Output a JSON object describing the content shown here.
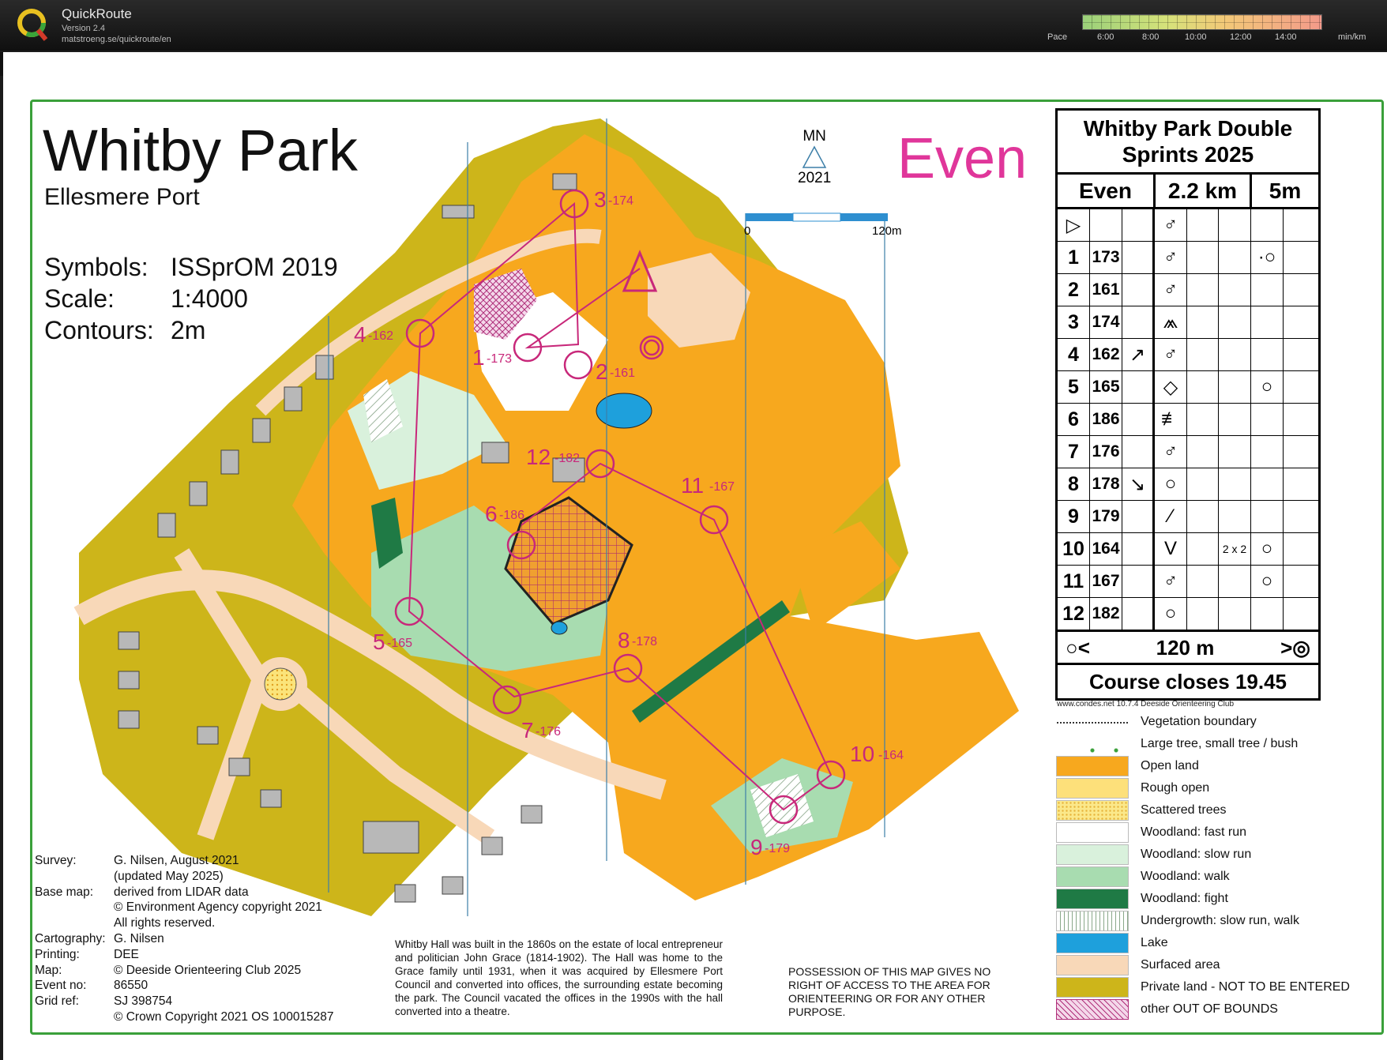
{
  "app": {
    "name": "QuickRoute",
    "version": "Version 2.4",
    "url": "matstroeng.se/quickroute/en",
    "pace_label": "Pace",
    "pace_ticks": [
      "6:00",
      "8:00",
      "10:00",
      "12:00",
      "14:00"
    ],
    "pace_unit": "min/km"
  },
  "map": {
    "title": "Whitby Park",
    "subtitle": "Ellesmere Port",
    "info": [
      {
        "label": "Symbols:",
        "value": "ISSprOM 2019"
      },
      {
        "label": "Scale:",
        "value": "1:4000"
      },
      {
        "label": "Contours:",
        "value": "2m"
      }
    ],
    "course_name": "Even",
    "north_label": "MN",
    "year_label": "2021",
    "scale_start": "0",
    "scale_end": "120m",
    "controls_on_map": [
      {
        "num": "1",
        "code": "-173"
      },
      {
        "num": "2",
        "code": "-161"
      },
      {
        "num": "3",
        "code": "-174"
      },
      {
        "num": "4",
        "code": "-162"
      },
      {
        "num": "5",
        "code": "-165"
      },
      {
        "num": "6",
        "code": "-186"
      },
      {
        "num": "7",
        "code": "-176"
      },
      {
        "num": "8",
        "code": "-178"
      },
      {
        "num": "9",
        "code": "-179"
      },
      {
        "num": "10",
        "code": "-164"
      },
      {
        "num": "11",
        "code": "-167"
      },
      {
        "num": "12",
        "code": "-182"
      }
    ]
  },
  "control_card": {
    "title_line1": "Whitby Park Double",
    "title_line2": "Sprints 2025",
    "course": "Even",
    "length": "2.2 km",
    "climb": "5m",
    "start_symbol": "▷",
    "rows": [
      {
        "num": "1",
        "code": "173",
        "dir": "",
        "feature": "♂",
        "dim": "",
        "loc": "·○"
      },
      {
        "num": "2",
        "code": "161",
        "dir": "",
        "feature": "♂",
        "dim": "",
        "loc": ""
      },
      {
        "num": "3",
        "code": "174",
        "dir": "",
        "feature": "⩕",
        "dim": "",
        "loc": ""
      },
      {
        "num": "4",
        "code": "162",
        "dir": "↗",
        "feature": "♂",
        "dim": "",
        "loc": ""
      },
      {
        "num": "5",
        "code": "165",
        "dir": "",
        "feature": "◇",
        "dim": "",
        "loc": "○"
      },
      {
        "num": "6",
        "code": "186",
        "dir": "",
        "feature": "≢",
        "dim": "",
        "loc": ""
      },
      {
        "num": "7",
        "code": "176",
        "dir": "",
        "feature": "♂",
        "dim": "",
        "loc": ""
      },
      {
        "num": "8",
        "code": "178",
        "dir": "↘",
        "feature": "○",
        "dim": "",
        "loc": ""
      },
      {
        "num": "9",
        "code": "179",
        "dir": "",
        "feature": "⁄",
        "dim": "",
        "loc": ""
      },
      {
        "num": "10",
        "code": "164",
        "dir": "",
        "feature": "V",
        "dim": "2 x 2",
        "loc": "○"
      },
      {
        "num": "11",
        "code": "167",
        "dir": "",
        "feature": "♂",
        "dim": "",
        "loc": "○"
      },
      {
        "num": "12",
        "code": "182",
        "dir": "",
        "feature": "○",
        "dim": "",
        "loc": ""
      }
    ],
    "finish_distance": "120 m",
    "finish_left": "○<",
    "finish_right": ">◎",
    "course_closes": "Course closes 19.45",
    "software": "www.condes.net 10.7.4 Deeside Orienteering Club"
  },
  "legend": [
    {
      "label": "Vegetation boundary",
      "swatch": "boundary"
    },
    {
      "label": "Large tree, small tree / bush",
      "swatch": "trees"
    },
    {
      "label": "Open land",
      "color": "#f7a81e"
    },
    {
      "label": "Rough open",
      "color": "#fde07a"
    },
    {
      "label": "Scattered trees",
      "color": "#fbe88a"
    },
    {
      "label": "Woodland: fast run",
      "color": "#ffffff"
    },
    {
      "label": "Woodland: slow run",
      "color": "#d9f1dc"
    },
    {
      "label": "Woodland: walk",
      "color": "#a8dcb0"
    },
    {
      "label": "Woodland: fight",
      "color": "#1f7a45"
    },
    {
      "label": "Undergrowth: slow run, walk",
      "swatch": "undergrowth"
    },
    {
      "label": "Lake",
      "color": "#1ea0dc"
    },
    {
      "label": "Surfaced area",
      "color": "#f8d8b8"
    },
    {
      "label": "Private land - NOT TO BE ENTERED",
      "color": "#cdb51a"
    },
    {
      "label": "other OUT OF BOUNDS",
      "swatch": "oob"
    }
  ],
  "credits": [
    {
      "label": "Survey:",
      "value": "G. Nilsen, August 2021"
    },
    {
      "label": "",
      "value": "(updated May 2025)"
    },
    {
      "label": "Base map:",
      "value": "derived from LIDAR data"
    },
    {
      "label": "",
      "value": "© Environment Agency copyright 2021"
    },
    {
      "label": "",
      "value": "All rights reserved."
    },
    {
      "label": "Cartography:",
      "value": "G. Nilsen"
    },
    {
      "label": "Printing:",
      "value": "DEE"
    },
    {
      "label": "Map:",
      "value": "© Deeside Orienteering Club 2025"
    },
    {
      "label": "Event no:",
      "value": "86550"
    },
    {
      "label": "Grid ref:",
      "value": "SJ 398754"
    },
    {
      "label": "",
      "value": "© Crown Copyright 2021 OS 100015287"
    }
  ],
  "history": "Whitby Hall was built in the 1860s on the estate of local entrepreneur and politician John Grace (1814-1902). The Hall was home to the Grace family until 1931, when it was acquired by Ellesmere Port Council and converted into offices, the surrounding estate becoming the park. The Council vacated the offices in the 1990s with the hall converted into a theatre.",
  "access_notice": "POSSESSION OF THIS MAP GIVES NO RIGHT OF ACCESS TO THE AREA FOR ORIENTEERING OR FOR ANY OTHER PURPOSE.",
  "colors": {
    "course": "#c8287a",
    "open": "#f7a81e",
    "private": "#cdb51a",
    "frame": "#3aa03a"
  }
}
